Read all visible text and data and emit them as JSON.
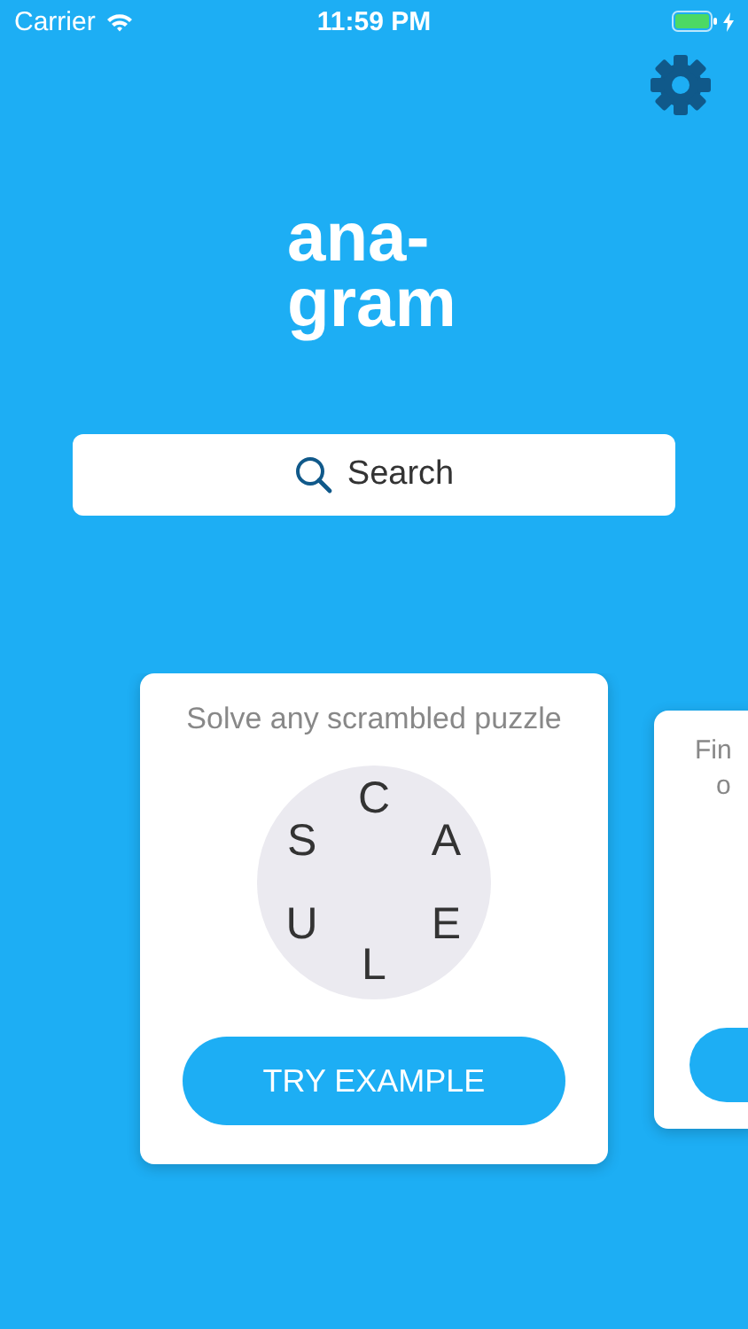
{
  "status_bar": {
    "carrier": "Carrier",
    "time": "11:59 PM"
  },
  "title_lines": [
    "ana-",
    "gram"
  ],
  "search": {
    "placeholder": "Search"
  },
  "cards": [
    {
      "caption": "Solve any scrambled puzzle",
      "letters": [
        "C",
        "A",
        "E",
        "L",
        "U",
        "S"
      ],
      "button": "TRY EXAMPLE"
    },
    {
      "caption_lines": [
        "Fin",
        "o"
      ]
    }
  ]
}
